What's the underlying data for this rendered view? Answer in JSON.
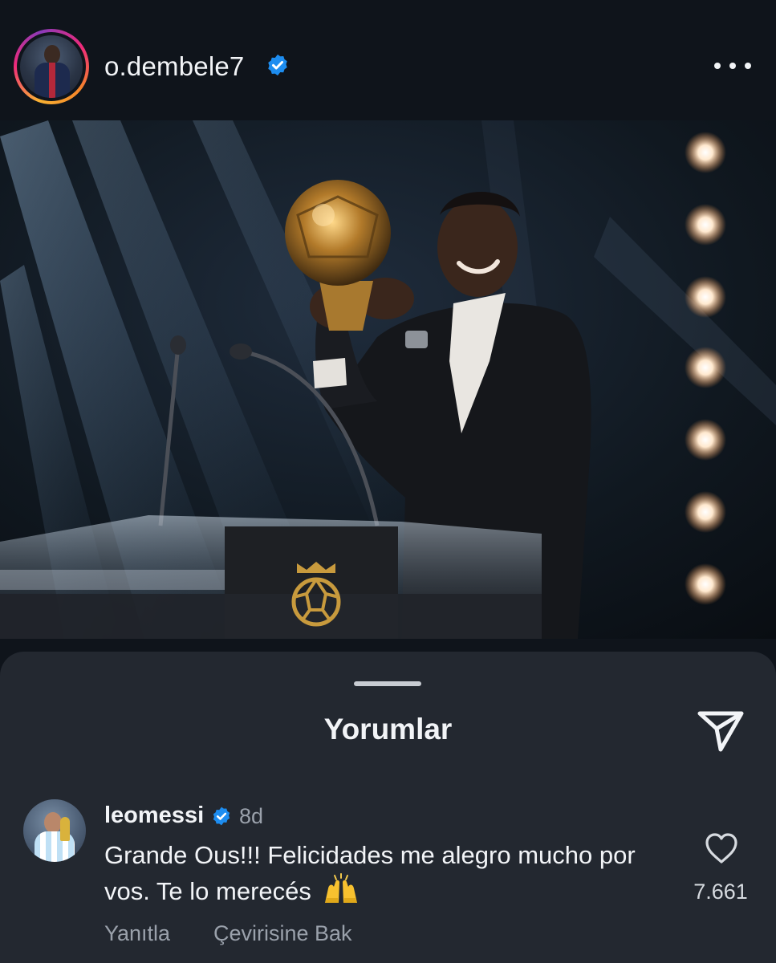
{
  "post": {
    "username": "o.dembele7",
    "avatar_icon": "profile-avatar",
    "more_icon": "more-horizontal-icon"
  },
  "colors": {
    "background": "#0f141b",
    "sheet": "#232830",
    "verified": "#1d8df0",
    "muted_text": "#9aa1ab"
  },
  "comments_sheet": {
    "title": "Yorumlar",
    "share_icon": "paper-plane-icon",
    "comments": [
      {
        "username": "leomessi",
        "verified": true,
        "time": "8d",
        "text": "Grande Ous!!! Felicidades me alegro mucho por vos. Te lo merecés",
        "emoji": "🙌",
        "likes": "7.661",
        "reply_label": "Yanıtla",
        "translate_label": "Çevirisine Bak"
      }
    ]
  }
}
